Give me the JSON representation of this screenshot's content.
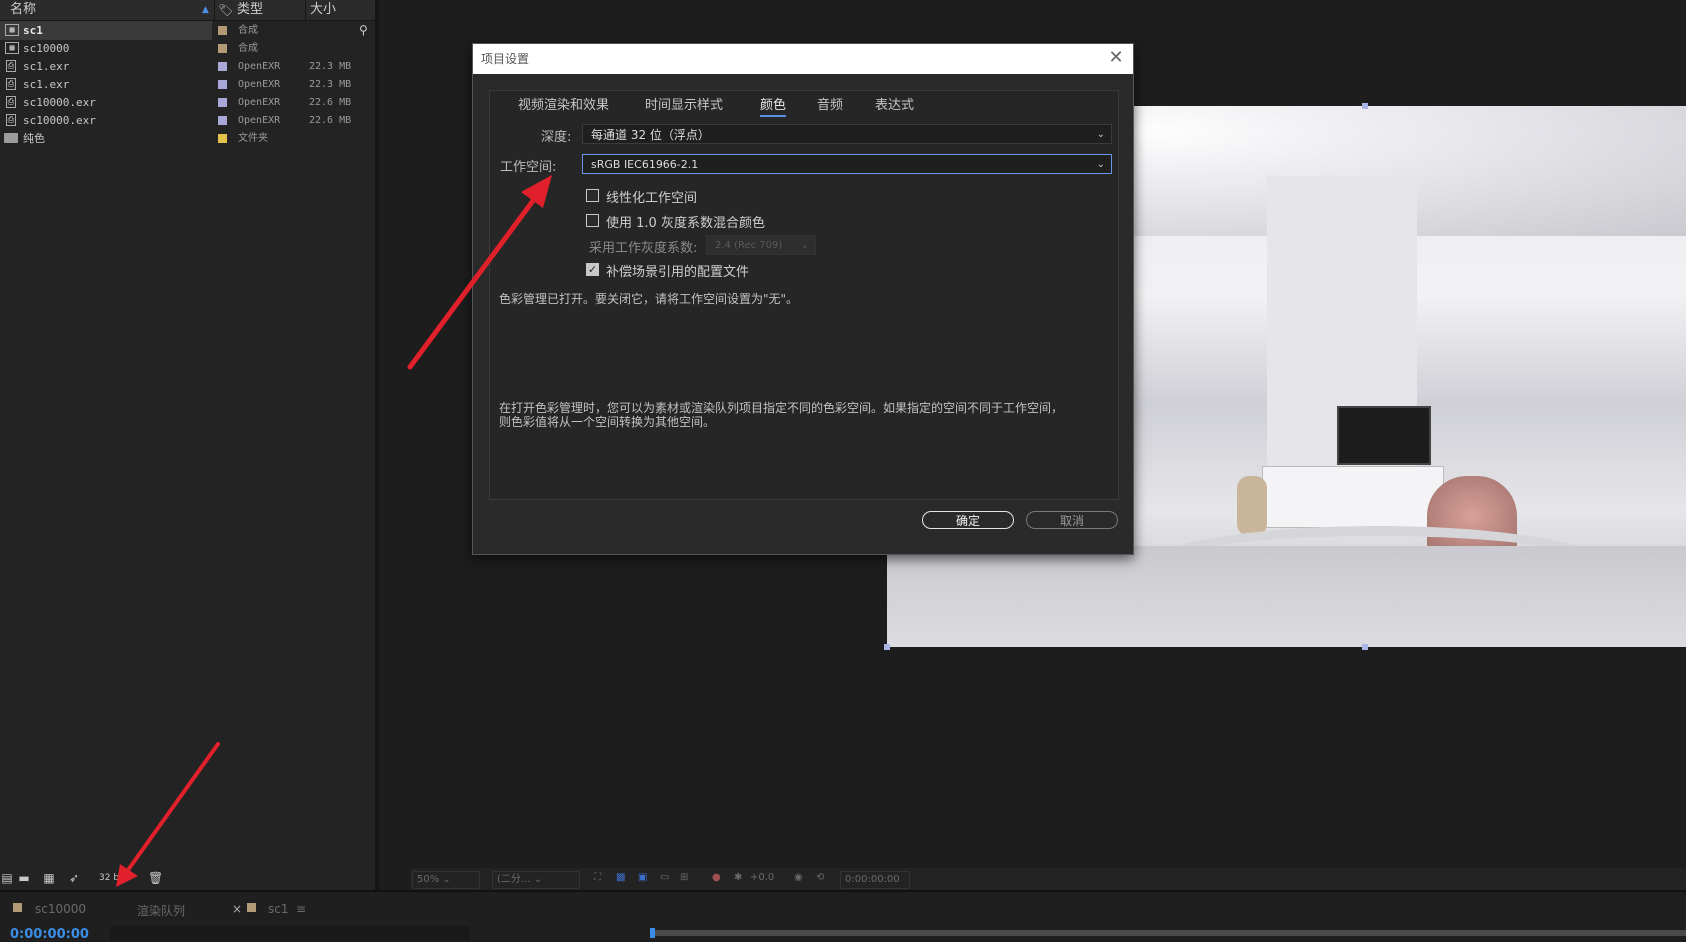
{
  "project": {
    "columns": {
      "name": "名称",
      "type": "类型",
      "size": "大小"
    },
    "items": [
      {
        "name": "sc1",
        "type": "合成",
        "size": "",
        "color": "#b39a76",
        "icon": "comp-icon"
      },
      {
        "name": "sc10000",
        "type": "合成",
        "size": "",
        "color": "#b39a76",
        "icon": "comp-icon"
      },
      {
        "name": "sc1.exr",
        "type": "OpenEXR",
        "size": "22.3 MB",
        "color": "#a9a6d8",
        "icon": "image-file-icon"
      },
      {
        "name": "sc1.exr",
        "type": "OpenEXR",
        "size": "22.3 MB",
        "color": "#a9a6d8",
        "icon": "image-file-icon"
      },
      {
        "name": "sc10000.exr",
        "type": "OpenEXR",
        "size": "22.6 MB",
        "color": "#a9a6d8",
        "icon": "image-file-icon"
      },
      {
        "name": "sc10000.exr",
        "type": "OpenEXR",
        "size": "22.6 MB",
        "color": "#a9a6d8",
        "icon": "image-file-icon"
      },
      {
        "name": "纯色",
        "type": "文件夹",
        "size": "",
        "color": "#e2c24a",
        "icon": "folder-icon"
      }
    ],
    "bpc": "32 bpc"
  },
  "viewer": {
    "zoom": "50%",
    "resolution": "(二分...",
    "exposure": "+0.0",
    "timecode": "0:00:00:00"
  },
  "timeline": {
    "tabs": [
      "sc10000",
      "渲染队列",
      "sc1"
    ],
    "timecode": "0:00:00:00"
  },
  "dialog": {
    "title": "项目设置",
    "tabs": [
      "视频渲染和效果",
      "时间显示样式",
      "颜色",
      "音频",
      "表达式"
    ],
    "active_tab": "颜色",
    "depth_label": "深度:",
    "depth_value": "每通道 32 位（浮点）",
    "workspace_label": "工作空间:",
    "workspace_value": "sRGB IEC61966-2.1",
    "options": [
      {
        "label": "线性化工作空间",
        "checked": false
      },
      {
        "label": "使用 1.0 灰度系数混合颜色",
        "checked": false
      }
    ],
    "gamma_label": "采用工作灰度系数:",
    "gamma_value": "2.4 (Rec 709)",
    "compensate_label": "补偿场景引用的配置文件",
    "compensate_checked": true,
    "info1": "色彩管理已打开。要关闭它，请将工作空间设置为\"无\"。",
    "info2_line1": "在打开色彩管理时，您可以为素材或渲染队列项目指定不同的色彩空间。如果指定的空间不同于工作空间，",
    "info2_line2": "则色彩值将从一个空间转换为其他空间。",
    "ok": "确定",
    "cancel": "取消"
  }
}
